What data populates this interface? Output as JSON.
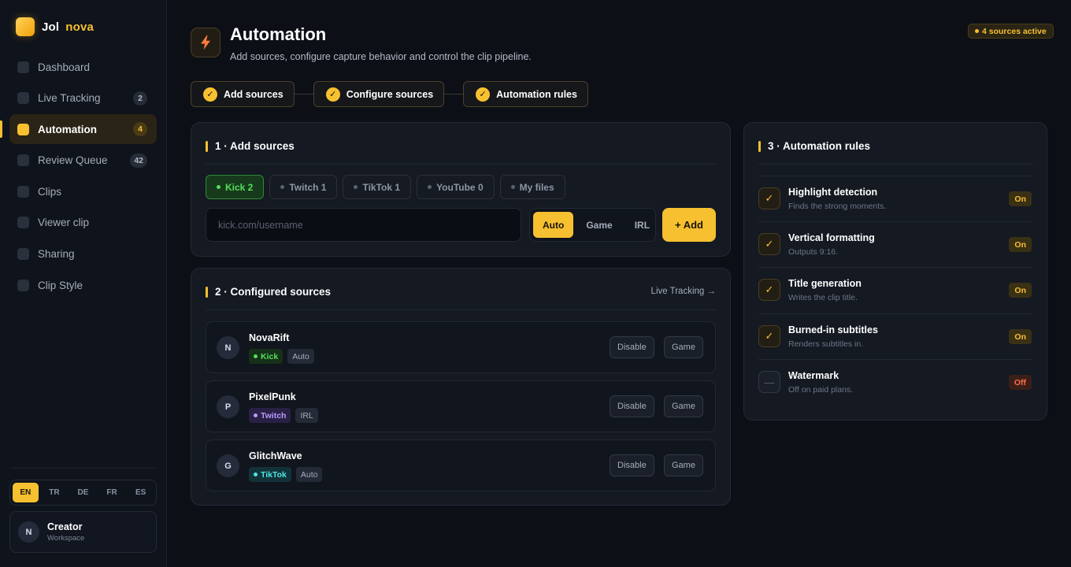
{
  "brand": {
    "name_part1": "Jol",
    "name_part2": "nova"
  },
  "nav": {
    "items": [
      {
        "label": "Dashboard",
        "badge": null
      },
      {
        "label": "Live Tracking",
        "badge": "2"
      },
      {
        "label": "Automation",
        "badge": "4"
      },
      {
        "label": "Review Queue",
        "badge": "42"
      },
      {
        "label": "Clips",
        "badge": null
      },
      {
        "label": "Viewer clip",
        "badge": null
      },
      {
        "label": "Sharing",
        "badge": null
      },
      {
        "label": "Clip Style",
        "badge": null
      }
    ],
    "active": "Automation"
  },
  "languages": [
    "EN",
    "TR",
    "DE",
    "FR",
    "ES"
  ],
  "active_language": "EN",
  "user": {
    "initial": "N",
    "name": "Creator",
    "role": "Workspace"
  },
  "header": {
    "title": "Automation",
    "subtitle": "Add sources, configure capture behavior and control the clip pipeline.",
    "active_pill": "4 sources active",
    "icon": "lightning-icon"
  },
  "steps": [
    {
      "label": "Add sources",
      "check": "✓"
    },
    {
      "label": "Configure sources",
      "check": "✓"
    },
    {
      "label": "Automation rules",
      "check": "✓"
    }
  ],
  "add_sources": {
    "title": "1 · Add sources",
    "tabs": [
      "Kick 2",
      "Twitch 1",
      "TikTok 1",
      "YouTube 0",
      "My files"
    ],
    "active_tab": "Kick 2",
    "input_placeholder": "kick.com/username",
    "modes": [
      "Auto",
      "Game",
      "IRL"
    ],
    "active_mode": "Auto",
    "add_label": "+ Add"
  },
  "configured_sources": {
    "title": "2 · Configured sources",
    "link": "Live Tracking →",
    "rows": [
      {
        "initial": "N",
        "name": "NovaRift",
        "platform": "Kick",
        "mode": "Auto",
        "disable_label": "Disable",
        "type_label": "Game"
      },
      {
        "initial": "P",
        "name": "PixelPunk",
        "platform": "Twitch",
        "mode": "IRL",
        "disable_label": "Disable",
        "type_label": "Game"
      },
      {
        "initial": "G",
        "name": "GlitchWave",
        "platform": "TikTok",
        "mode": "Auto",
        "disable_label": "Disable",
        "type_label": "Game"
      }
    ]
  },
  "automation_rules": {
    "title": "3 · Automation rules",
    "rules": [
      {
        "name": "Highlight detection",
        "desc": "Finds the strong moments.",
        "state": "On",
        "mark": "✓"
      },
      {
        "name": "Vertical formatting",
        "desc": "Outputs 9:16.",
        "state": "On",
        "mark": "✓"
      },
      {
        "name": "Title generation",
        "desc": "Writes the clip title.",
        "state": "On",
        "mark": "✓"
      },
      {
        "name": "Burned-in subtitles",
        "desc": "Renders subtitles in.",
        "state": "On",
        "mark": "✓"
      },
      {
        "name": "Watermark",
        "desc": "Off on paid plans.",
        "state": "Off",
        "mark": "—"
      }
    ]
  },
  "colors": {
    "accent": "#f6c030",
    "kick": "#53e15a",
    "twitch": "#b79aff",
    "tiktok": "#4fe6e0",
    "off": "#ff6d4a"
  }
}
